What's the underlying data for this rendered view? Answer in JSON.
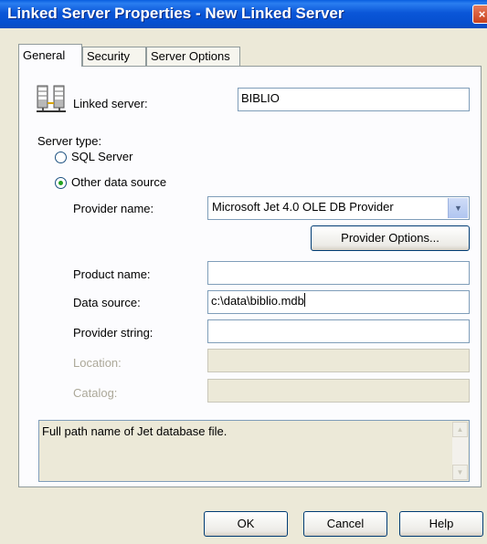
{
  "window": {
    "title": "Linked Server Properties - New Linked Server",
    "close_glyph": "×"
  },
  "tabs": [
    {
      "label": "General",
      "active": true
    },
    {
      "label": "Security",
      "active": false
    },
    {
      "label": "Server Options",
      "active": false
    }
  ],
  "general": {
    "linked_server": {
      "label": "Linked server:",
      "value": "BIBLIO",
      "icon": "server-icon"
    },
    "server_type": {
      "label": "Server type:",
      "options": [
        {
          "label": "SQL Server",
          "checked": false
        },
        {
          "label": "Other data source",
          "checked": true
        }
      ]
    },
    "provider_name": {
      "label": "Provider name:",
      "value": "Microsoft Jet 4.0 OLE DB Provider"
    },
    "provider_options_button": "Provider Options...",
    "product_name": {
      "label": "Product name:",
      "value": ""
    },
    "data_source": {
      "label": "Data source:",
      "value": "c:\\data\\biblio.mdb"
    },
    "provider_string": {
      "label": "Provider string:",
      "value": ""
    },
    "location": {
      "label": "Location:",
      "value": "",
      "disabled": true
    },
    "catalog": {
      "label": "Catalog:",
      "value": "",
      "disabled": true
    },
    "description": "Full path name of Jet database file."
  },
  "buttons": {
    "ok": "OK",
    "cancel": "Cancel",
    "help": "Help"
  },
  "colors": {
    "titlebar": "#0a56d8",
    "dialog_bg": "#ece9d8",
    "panel_bg": "#fcfcfe",
    "radio_dot": "#21a121"
  }
}
